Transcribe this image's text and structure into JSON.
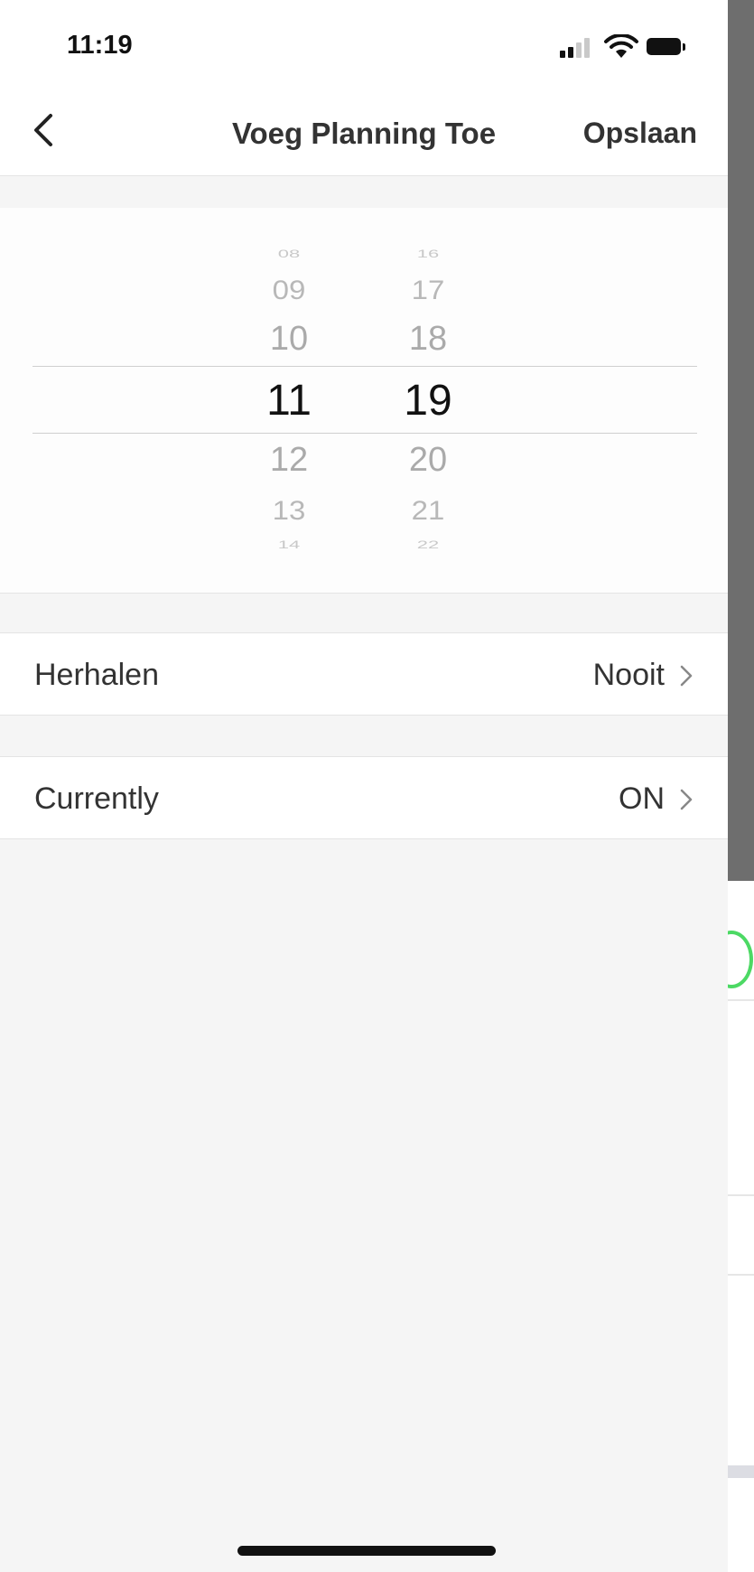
{
  "status_bar": {
    "time": "11:19",
    "icons": [
      "signal-icon",
      "wifi-icon",
      "battery-icon"
    ]
  },
  "nav": {
    "back_icon": "chevron-left-icon",
    "title": "Voeg Planning Toe",
    "save_label": "Opslaan"
  },
  "picker": {
    "hours": [
      "08",
      "09",
      "10",
      "11",
      "12",
      "13",
      "14"
    ],
    "minutes": [
      "16",
      "17",
      "18",
      "19",
      "20",
      "21",
      "22"
    ],
    "selected_hour": "11",
    "selected_minute": "19"
  },
  "rows": [
    {
      "label": "Herhalen",
      "value": "Nooit",
      "icon": "chevron-right-icon"
    },
    {
      "label": "Currently",
      "value": "ON",
      "icon": "chevron-right-icon"
    }
  ],
  "colors": {
    "background": "#f5f5f5",
    "surface": "#ffffff",
    "text": "#333333",
    "picker_dim": "#b4b4b4",
    "peek_toggle": "#4cd964"
  }
}
